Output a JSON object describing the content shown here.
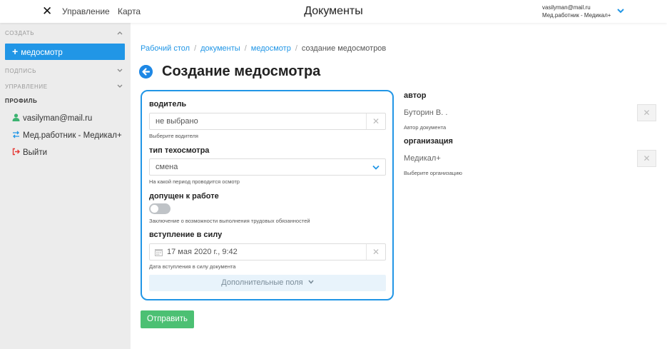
{
  "topbar": {
    "close_icon_glyph": "✕",
    "nav": {
      "manage": "Управление",
      "map": "Карта"
    },
    "title": "Документы",
    "user": {
      "email": "vasilyman@mail.ru",
      "role": "Мед.работник - Медикал+"
    }
  },
  "sidebar": {
    "create_section": "СОЗДАТЬ",
    "active_item": "медосмотр",
    "sign_section": "ПОДПИСЬ",
    "manage_section": "УПРАВЛЕНИЕ",
    "profile_section": "ПРОФИЛЬ",
    "profile_items": [
      {
        "label": "vasilyman@mail.ru",
        "icon": "user-icon"
      },
      {
        "label": "Мед.работник - Медикал+",
        "icon": "switch-icon"
      },
      {
        "label": "Выйти",
        "icon": "logout-icon"
      }
    ]
  },
  "breadcrumb": [
    "Рабочий стол",
    "документы",
    "медосмотр",
    "создание медосмотров"
  ],
  "page_title": "Создание медосмотра",
  "form": {
    "driver": {
      "label": "водитель",
      "value": "не выбрано",
      "help": "Выберите водителя"
    },
    "inspection_type": {
      "label": "тип техосмотра",
      "value": "смена",
      "help": "На какой период проводится осмотр"
    },
    "admitted": {
      "label": "допущен к работе",
      "checked": false,
      "help": "Заключение о возможности выполнения трудовых обязанностей"
    },
    "effective": {
      "label": "вступление в силу",
      "value": "17 мая 2020 г., 9:42",
      "help": "Дата вступления в силу документа"
    },
    "extra_fields": "Дополнительные поля"
  },
  "submit_label": "Отправить",
  "right": {
    "author": {
      "label": "автор",
      "value": "Буторин В. .",
      "help": "Автор документа"
    },
    "organization": {
      "label": "организация",
      "value": "Медикал+",
      "help": "Выберите организацию"
    }
  },
  "colors": {
    "accent": "#2196e6",
    "submit": "#4cc073",
    "sidebar_bg": "#ececec"
  }
}
